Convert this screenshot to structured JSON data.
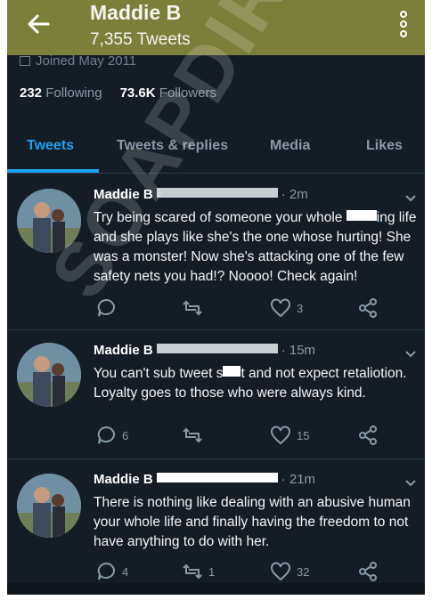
{
  "header": {
    "profile_name": "Maddie B",
    "tweet_count": "7,355 Tweets",
    "back_icon": "arrow-left-icon",
    "more_icon": "more-vertical-icon"
  },
  "profile": {
    "joined": "Joined May 2011",
    "following_count": "232",
    "following_label": "Following",
    "followers_count": "73.6K",
    "followers_label": "Followers"
  },
  "tabs": [
    {
      "label": "Tweets",
      "active": true
    },
    {
      "label": "Tweets & replies",
      "active": false
    },
    {
      "label": "Media",
      "active": false
    },
    {
      "label": "Likes",
      "active": false
    }
  ],
  "tweets": [
    {
      "name": "Maddie B",
      "time": "2m",
      "text_a": "Try being scared of someone your whole ",
      "text_b": "ing life and she plays like she's the one whose hurting! She was a monster! Now she's attacking one of the few safety nets you had!? Noooo! Check again!",
      "replies": "",
      "retweets": "",
      "likes": "3"
    },
    {
      "name": "Maddie B",
      "time": "15m",
      "text_a": "You can't sub tweet s",
      "text_b": "t and not expect retaliotion. Loyalty goes to those who were always kind.",
      "replies": "6",
      "retweets": "",
      "likes": "15"
    },
    {
      "name": "Maddie B",
      "time": "21m",
      "text_a": "There is nothing like dealing with an abusive human your whole life and finally having the freedom to not have anything to do with her.",
      "text_b": "",
      "replies": "4",
      "retweets": "1",
      "likes": "32"
    }
  ],
  "watermark": "SOAPDIRT",
  "colors": {
    "background": "#141d26",
    "header": "#7c7f3a",
    "accent": "#1da1f2",
    "muted": "#8899a6"
  }
}
